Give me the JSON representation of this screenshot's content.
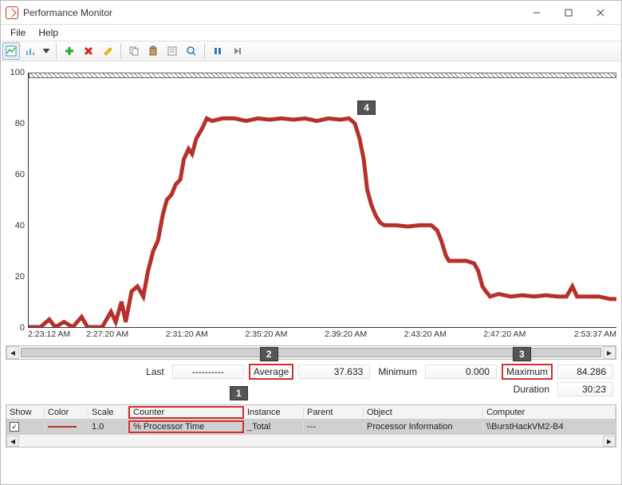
{
  "window": {
    "title": "Performance Monitor"
  },
  "menu": {
    "file": "File",
    "help": "Help"
  },
  "callouts": {
    "c1": "1",
    "c2": "2",
    "c3": "3",
    "c4": "4"
  },
  "stats": {
    "last_label": "Last",
    "last_value": "----------",
    "average_label": "Average",
    "average_value": "37.633",
    "minimum_label": "Minimum",
    "minimum_value": "0.000",
    "maximum_label": "Maximum",
    "maximum_value": "84.286",
    "duration_label": "Duration",
    "duration_value": "30:23"
  },
  "grid": {
    "headers": {
      "show": "Show",
      "color": "Color",
      "scale": "Scale",
      "counter": "Counter",
      "instance": "Instance",
      "parent": "Parent",
      "object": "Object",
      "computer": "Computer"
    },
    "row": {
      "checked": "✓",
      "scale": "1.0",
      "counter": "% Processor Time",
      "instance": "_Total",
      "parent": "---",
      "object": "Processor Information",
      "computer": "\\\\BurstHackVM2-B4"
    }
  },
  "chart_data": {
    "type": "line",
    "ylim": [
      0,
      100
    ],
    "yticks": [
      0,
      20,
      40,
      60,
      80,
      100
    ],
    "xlabels": [
      "2:23:12 AM",
      "2:27:20 AM",
      "2:31:20 AM",
      "2:35:20 AM",
      "2:39:20 AM",
      "2:43:20 AM",
      "2:47:20 AM",
      "2:53:37 AM"
    ],
    "xpos": [
      0.0,
      0.135,
      0.27,
      0.405,
      0.54,
      0.675,
      0.81,
      1.0
    ],
    "series": {
      "name": "% Processor Time",
      "color": "#b7302a",
      "points": [
        [
          0.0,
          0
        ],
        [
          0.02,
          0
        ],
        [
          0.035,
          3
        ],
        [
          0.045,
          0
        ],
        [
          0.06,
          2
        ],
        [
          0.075,
          0
        ],
        [
          0.09,
          4
        ],
        [
          0.1,
          0
        ],
        [
          0.115,
          0
        ],
        [
          0.125,
          0
        ],
        [
          0.14,
          6
        ],
        [
          0.148,
          2
        ],
        [
          0.158,
          10
        ],
        [
          0.165,
          2
        ],
        [
          0.175,
          14
        ],
        [
          0.185,
          16
        ],
        [
          0.195,
          12
        ],
        [
          0.203,
          22
        ],
        [
          0.212,
          30
        ],
        [
          0.22,
          34
        ],
        [
          0.228,
          44
        ],
        [
          0.235,
          50
        ],
        [
          0.243,
          52
        ],
        [
          0.25,
          56
        ],
        [
          0.258,
          58
        ],
        [
          0.264,
          66
        ],
        [
          0.272,
          70
        ],
        [
          0.278,
          68
        ],
        [
          0.285,
          74
        ],
        [
          0.295,
          78
        ],
        [
          0.303,
          82
        ],
        [
          0.312,
          81
        ],
        [
          0.33,
          82
        ],
        [
          0.35,
          82
        ],
        [
          0.37,
          81
        ],
        [
          0.39,
          82
        ],
        [
          0.41,
          81.5
        ],
        [
          0.43,
          82
        ],
        [
          0.45,
          81.5
        ],
        [
          0.47,
          82
        ],
        [
          0.49,
          81
        ],
        [
          0.51,
          82
        ],
        [
          0.53,
          81.5
        ],
        [
          0.545,
          82
        ],
        [
          0.555,
          80
        ],
        [
          0.563,
          74
        ],
        [
          0.57,
          66
        ],
        [
          0.576,
          54
        ],
        [
          0.583,
          48
        ],
        [
          0.59,
          44
        ],
        [
          0.598,
          41
        ],
        [
          0.605,
          40
        ],
        [
          0.625,
          40
        ],
        [
          0.645,
          39.5
        ],
        [
          0.665,
          40
        ],
        [
          0.685,
          40
        ],
        [
          0.695,
          38
        ],
        [
          0.702,
          34
        ],
        [
          0.71,
          28
        ],
        [
          0.715,
          26
        ],
        [
          0.73,
          26
        ],
        [
          0.745,
          26
        ],
        [
          0.758,
          25
        ],
        [
          0.765,
          22
        ],
        [
          0.772,
          16
        ],
        [
          0.778,
          14
        ],
        [
          0.785,
          12
        ],
        [
          0.8,
          13
        ],
        [
          0.82,
          12
        ],
        [
          0.84,
          12.5
        ],
        [
          0.86,
          12
        ],
        [
          0.88,
          12.5
        ],
        [
          0.9,
          12
        ],
        [
          0.915,
          12
        ],
        [
          0.925,
          16
        ],
        [
          0.933,
          12
        ],
        [
          0.95,
          12
        ],
        [
          0.97,
          12
        ],
        [
          0.99,
          11
        ],
        [
          1.0,
          11
        ]
      ]
    }
  }
}
